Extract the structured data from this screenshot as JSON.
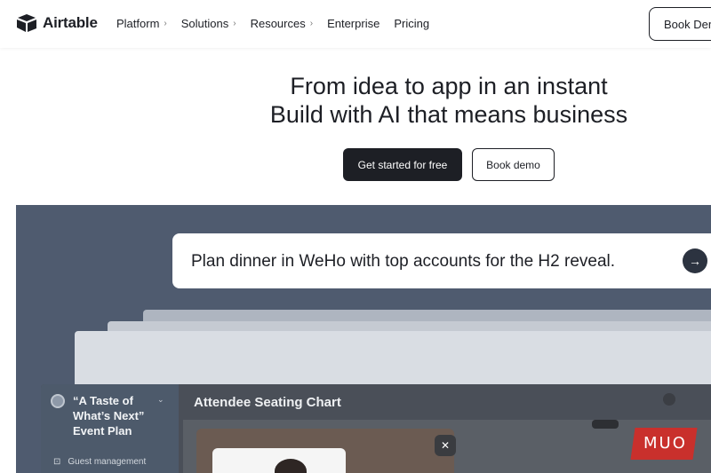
{
  "nav": {
    "logo": "Airtable",
    "links": [
      {
        "label": "Platform",
        "chevron": "›"
      },
      {
        "label": "Solutions",
        "chevron": "›"
      },
      {
        "label": "Resources",
        "chevron": "›"
      },
      {
        "label": "Enterprise",
        "chevron": ""
      },
      {
        "label": "Pricing",
        "chevron": ""
      }
    ],
    "book_demo": "Book Demo"
  },
  "hero": {
    "line1": "From idea to app in an instant",
    "line2": "Build with AI that means business",
    "primary_button": "Get started for free",
    "secondary_button": "Book demo"
  },
  "demo": {
    "prompt": "Plan dinner in WeHo with top accounts for the H2 reveal.",
    "send_icon": "→",
    "sidebar_title": "“A Taste of What’s Next” Event Plan",
    "sidebar_chevron": "⌄",
    "sidebar_item": "Guest management",
    "sidebar_item_icon": "⊡",
    "app_title": "Attendee Seating Chart",
    "close_icon": "✕"
  },
  "watermark": "MUO",
  "colors": {
    "primary": "#1d1f25",
    "demo_bg": "#4f5b6f",
    "watermark": "#c9302c"
  }
}
